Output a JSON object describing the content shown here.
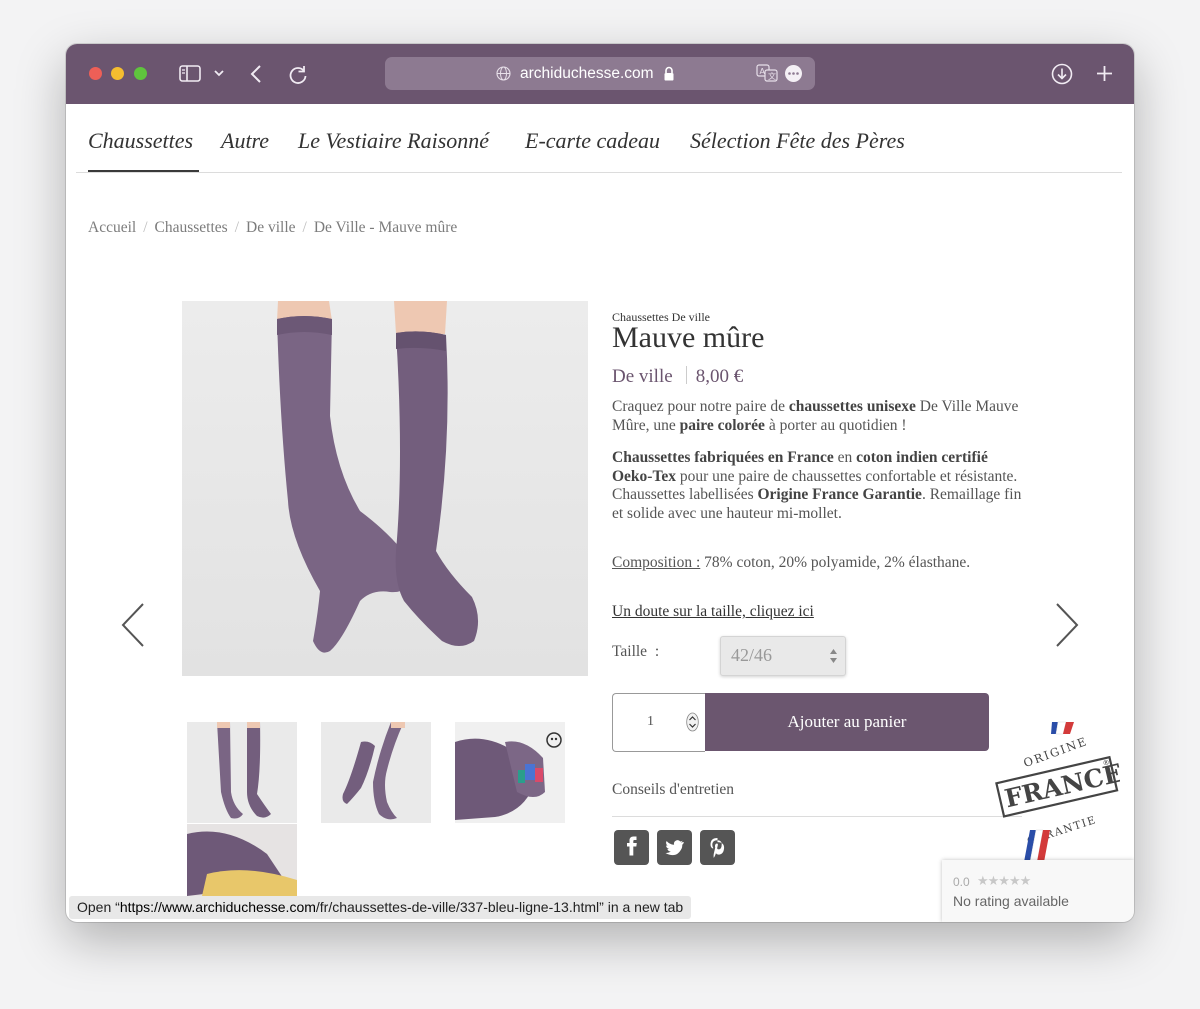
{
  "browser": {
    "url": "archiduchesse.com"
  },
  "nav": {
    "items": [
      "Chaussettes",
      "Autre",
      "Le Vestiaire Raisonné",
      "E-carte cadeau",
      "Sélection Fête des Pères"
    ]
  },
  "breadcrumb": [
    "Accueil",
    "Chaussettes",
    "De ville",
    "De Ville - Mauve mûre"
  ],
  "product": {
    "category": "Chaussettes De ville",
    "name": "Mauve mûre",
    "range": "De ville",
    "price": "8,00 €",
    "description_1": {
      "t1": "Craquez pour notre paire de ",
      "b1": "chaussettes unisexe",
      "t2": " De Ville Mauve Mûre, une ",
      "b2": "paire colorée",
      "t3": " à porter au quotidien !"
    },
    "description_2": {
      "b1": "Chaussettes fabriquées en France",
      "t1": " en ",
      "b2": "coton indien certifié Oeko-Tex",
      "t2": " pour une paire de chaussettes confortable et résistante. Chaussettes labellisées ",
      "b3": "Origine France Garantie",
      "t3": ". Remaillage fin et solide avec une hauteur mi-mollet."
    },
    "composition_label": "Composition :",
    "composition_value": " 78% coton, 20% polyamide, 2% élasthane.",
    "size_link": "Un doute sur la taille, cliquez ici",
    "size_label": "Taille  :",
    "size_value": "42/46",
    "quantity": "1",
    "add_to_cart": "Ajouter au panier",
    "care": "Conseils d'entretien"
  },
  "badge": {
    "top": "ORIGINE",
    "main": "FRANCE",
    "bottom": "GARANTIE",
    "reg": "®"
  },
  "rating": {
    "score": "0.0",
    "stars": "★★★★★",
    "text": "No rating available"
  },
  "tooltip": {
    "t1": "Open “",
    "host": "https://www.archiduchesse.com",
    "t2": "/fr/chaussettes-de-ville/337-bleu-ligne-13.html” in a new tab"
  },
  "colors": {
    "accent": "#6b556f",
    "sock": "#7a6584"
  }
}
